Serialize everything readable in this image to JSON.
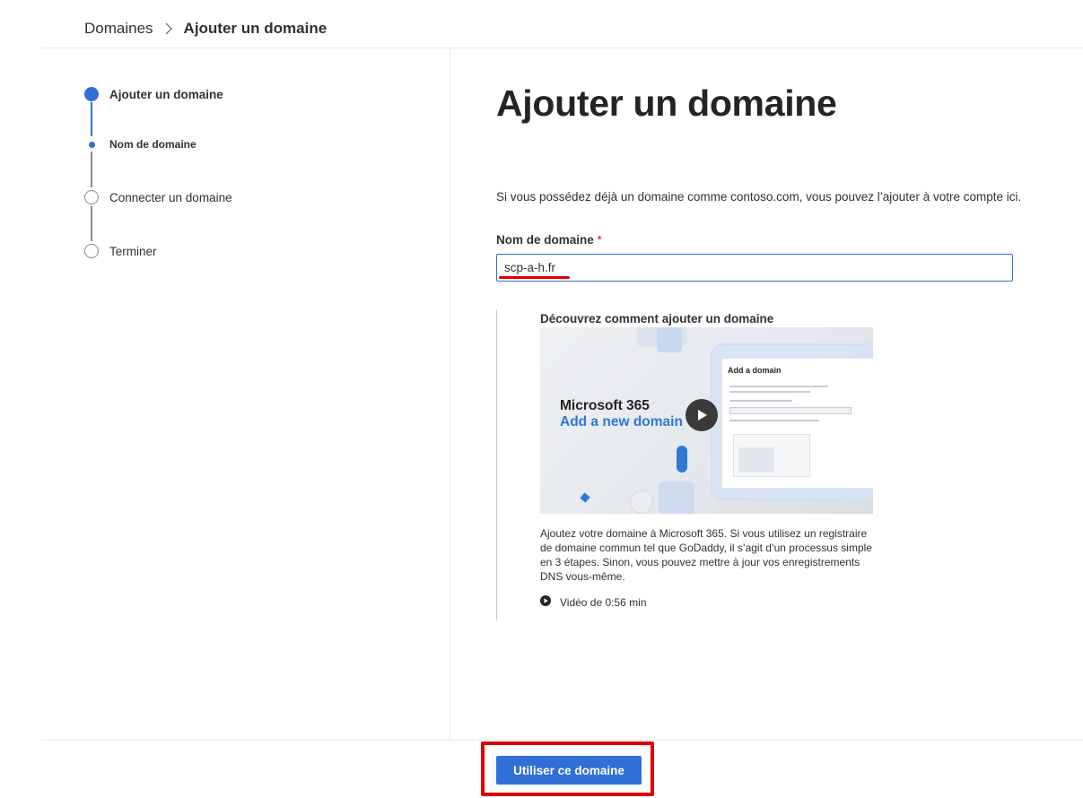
{
  "breadcrumb": {
    "root": "Domaines",
    "separator_icon": "chevron-right-icon",
    "current": "Ajouter un domaine"
  },
  "stepper": {
    "steps": [
      {
        "label": "Ajouter un domaine",
        "state": "current"
      },
      {
        "label": "Nom de domaine",
        "state": "current-substep"
      },
      {
        "label": "Connecter un domaine",
        "state": "pending"
      },
      {
        "label": "Terminer",
        "state": "pending"
      }
    ]
  },
  "main": {
    "title": "Ajouter un domaine",
    "intro": "Si vous possédez déjà un domaine comme contoso.com, vous pouvez l’ajouter à votre compte ici.",
    "domain_field": {
      "label": "Nom de domaine",
      "required_mark": "*",
      "value": "scp-a-h.fr"
    },
    "learn_card": {
      "title": "Découvrez comment ajouter un domaine",
      "video": {
        "brand": "Microsoft 365",
        "subtitle": "Add a new domain",
        "panel_title": "Add a domain",
        "play_icon": "play-icon"
      },
      "description": "Ajoutez votre domaine à Microsoft 365. Si vous utilisez un registraire de domaine commun tel que GoDaddy, il s’agit d’un processus simple en 3 étapes. Sinon, vous pouvez mettre à jour vos enregistrements DNS vous-même.",
      "duration": "Vidéo de 0:56 min"
    }
  },
  "footer": {
    "primary_button": "Utiliser ce domaine"
  },
  "colors": {
    "accent": "#2f6fd6",
    "annotation_red": "#e00000"
  }
}
